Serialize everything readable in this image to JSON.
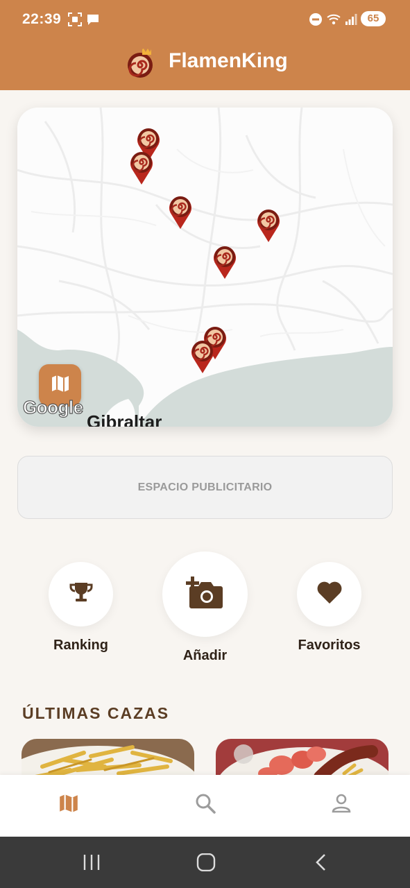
{
  "status_bar": {
    "time": "22:39",
    "battery": "65"
  },
  "app_bar": {
    "title": "FlamenKing"
  },
  "map": {
    "attribution": "Google",
    "place_label": "Gibraltar"
  },
  "ad_banner": {
    "label": "ESPACIO PUBLICITARIO"
  },
  "actions": [
    {
      "label": "Ranking",
      "icon": "trophy-icon"
    },
    {
      "label": "Añadir",
      "icon": "add-photo-icon"
    },
    {
      "label": "Favoritos",
      "icon": "heart-icon"
    }
  ],
  "section": {
    "title": "ÚLTIMAS CAZAS"
  },
  "bottom_nav": [
    {
      "icon": "map-icon",
      "active": true
    },
    {
      "icon": "search-icon",
      "active": false
    },
    {
      "icon": "profile-icon",
      "active": false
    }
  ],
  "colors": {
    "accent": "#cd844b",
    "dark_brown": "#5b3d24",
    "background": "#f8f5f1"
  }
}
